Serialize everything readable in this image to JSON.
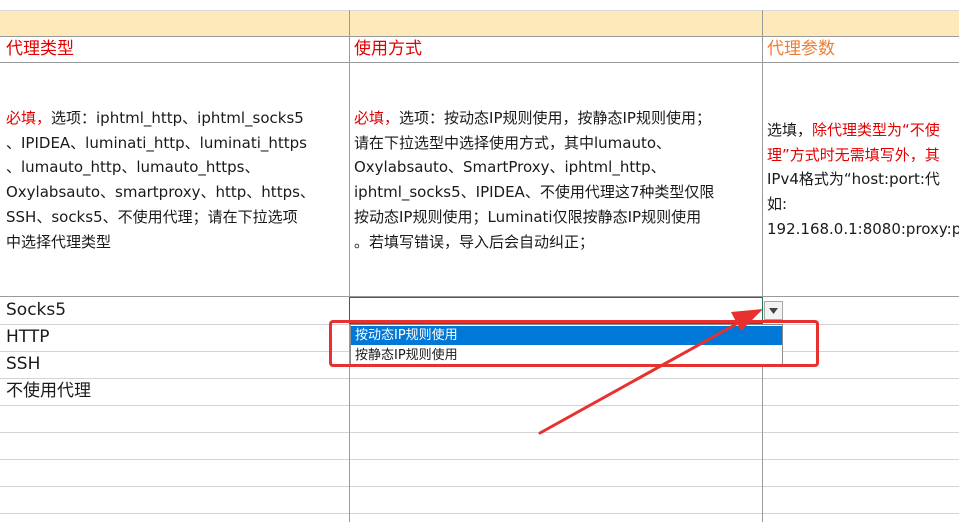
{
  "colors": {
    "header_band": "#fde9b9",
    "required_red": "#e30000",
    "header_orange": "#ed7d31",
    "selection_blue": "#0078d7",
    "annotation_red": "#e8312e"
  },
  "headers": {
    "proxy_type": "代理类型",
    "usage_mode": "使用方式",
    "proxy_params": "代理参数"
  },
  "descriptions": {
    "proxy_type": {
      "required": "必填，",
      "text": "选项：iphtml_http、iphtml_socks5\n、IPIDEA、luminati_http、luminati_https\n、lumauto_http、lumauto_https、\nOxylabsauto、smartproxy、http、https、\nSSH、socks5、不使用代理；请在下拉选项\n中选择代理类型"
    },
    "usage_mode": {
      "required": "必填，",
      "text": "选项：按动态IP规则使用，按静态IP规则使用；\n请在下拉选型中选择使用方式，其中lumauto、\nOxylabsauto、SmartProxy、iphtml_http、\niphtml_socks5、IPIDEA、不使用代理这7种类型仅限\n按动态IP规则使用；Luminati仅限按静态IP规则使用\n。若填写错误，导入后会自动纠正；"
    },
    "proxy_params": {
      "prefix": "选填，",
      "red1": "除代理类型为“不使",
      "red2": "理”方式时无需填写外，其",
      "text": "IPv4格式为“host:port:代\n如:\n192.168.0.1:8080:proxy:p"
    }
  },
  "rows": [
    "Socks5",
    "HTTP",
    "SSH",
    "不使用代理"
  ],
  "dropdown": {
    "options": [
      "按动态IP规则使用",
      "按静态IP规则使用"
    ],
    "selected_index": 0
  }
}
